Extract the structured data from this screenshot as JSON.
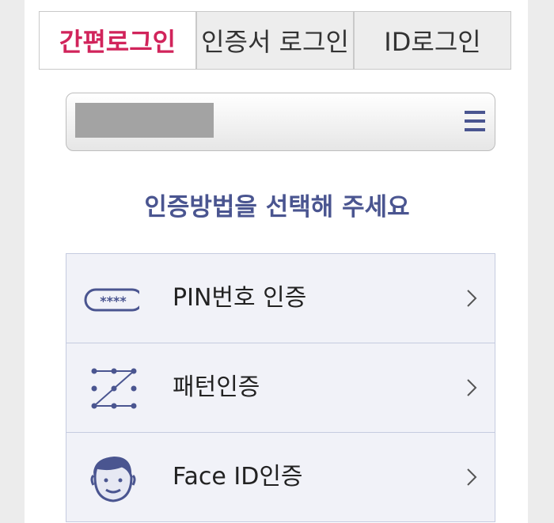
{
  "tabs": [
    {
      "label": "간편로그인",
      "active": true
    },
    {
      "label": "인증서 로그인",
      "active": false
    },
    {
      "label": "ID로그인",
      "active": false
    }
  ],
  "account_select": {
    "masked": true,
    "icon": "menu-icon"
  },
  "heading": "인증방법을 선택해 주세요",
  "methods": [
    {
      "label": "PIN번호 인증",
      "icon": "pin-icon",
      "icon_text": "****"
    },
    {
      "label": "패턴인증",
      "icon": "pattern-icon"
    },
    {
      "label": "Face ID인증",
      "icon": "face-id-icon"
    }
  ],
  "colors": {
    "accent": "#d1245b",
    "navy": "#4a5590",
    "list_bg": "#f1f2f8",
    "list_border": "#c5cbe0"
  }
}
